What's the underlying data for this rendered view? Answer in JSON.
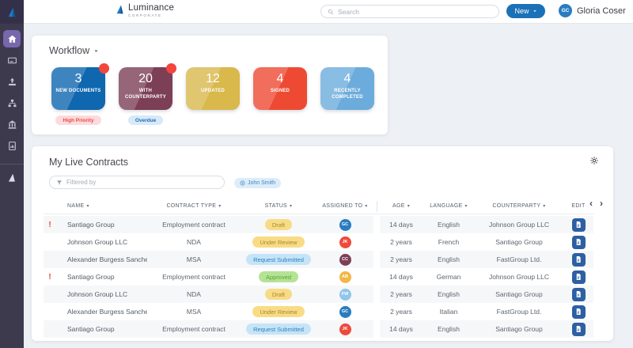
{
  "topbar": {
    "brand_name": "Luminance",
    "brand_sub": "CORPORATE",
    "search_placeholder": "Search",
    "new_label": "New",
    "user_initials": "GC",
    "user_name": "Gloria Coser"
  },
  "sidebar": {
    "items": [
      {
        "name": "home",
        "icon": "home-icon",
        "active": true
      },
      {
        "name": "documents",
        "icon": "card-icon",
        "active": false
      },
      {
        "name": "upload",
        "icon": "upload-icon",
        "active": false
      },
      {
        "name": "hierarchy",
        "icon": "hierarchy-icon",
        "active": false
      },
      {
        "name": "organisation",
        "icon": "bank-icon",
        "active": false
      },
      {
        "name": "reports",
        "icon": "report-icon",
        "active": false
      }
    ],
    "footer_icon": "sail-icon"
  },
  "workflow": {
    "title": "Workflow",
    "cards": [
      {
        "value": "3",
        "label": "NEW DOCUMENTS",
        "color": "#0e67af",
        "dot": true,
        "badge": {
          "text": "High Priority",
          "bg": "#fbdbdd",
          "color": "#ee4a42"
        }
      },
      {
        "value": "20",
        "label": "WITH COUNTERPARTY",
        "color": "#7c3f55",
        "dot": true,
        "badge": {
          "text": "Overdue",
          "bg": "#d8e9f8",
          "color": "#1e6fb8"
        }
      },
      {
        "value": "12",
        "label": "UPDATED",
        "color": "#d9b84c",
        "dot": false
      },
      {
        "value": "4",
        "label": "SIGNED",
        "color": "#ee4a33",
        "dot": false
      },
      {
        "value": "4",
        "label": "RECENTLY COMPLETED",
        "color": "#6cacdc",
        "dot": false
      }
    ]
  },
  "contracts": {
    "title": "My Live Contracts",
    "filter_placeholder": "Filtered by",
    "chip_label": "John Smith",
    "columns": [
      {
        "label": "NAME",
        "sortable": true
      },
      {
        "label": "CONTRACT TYPE",
        "sortable": true
      },
      {
        "label": "STATUS",
        "sortable": true
      },
      {
        "label": "ASSIGNED TO",
        "sortable": true
      },
      {
        "label": "AGE",
        "sortable": true
      },
      {
        "label": "LANGUAGE",
        "sortable": true
      },
      {
        "label": "COUNTERPARTY",
        "sortable": true
      },
      {
        "label": "EDIT",
        "sortable": false
      }
    ],
    "status_styles": {
      "Draft": {
        "bg": "#f8dc85",
        "color": "#a8872f"
      },
      "Under Review": {
        "bg": "#f8dc85",
        "color": "#a8872f"
      },
      "Request Submitted": {
        "bg": "#c6e4f7",
        "color": "#2b80c2"
      },
      "Approved": {
        "bg": "#b4e394",
        "color": "#5fa039"
      }
    },
    "avatar_colors": {
      "GC": "#2a7cc0",
      "JK": "#ee4a3b",
      "CC": "#7c4055",
      "AB": "#f2b843",
      "FW": "#8fc6ea"
    },
    "rows": [
      {
        "priority": true,
        "name": "Santiago Group",
        "type": "Employment contract",
        "status": "Draft",
        "assignee": "GC",
        "age": "14 days",
        "language": "English",
        "counterparty": "Johnson Group LLC"
      },
      {
        "priority": false,
        "name": "Johnson Group LLC",
        "type": "NDA",
        "status": "Under Review",
        "assignee": "JK",
        "age": "2 years",
        "language": "French",
        "counterparty": "Santiago Group"
      },
      {
        "priority": false,
        "name": "Alexander Burgess Sanchezz",
        "type": "MSA",
        "status": "Request Submitted",
        "assignee": "CC",
        "age": "2 years",
        "language": "English",
        "counterparty": "FastGroup Ltd."
      },
      {
        "priority": true,
        "name": "Santiago Group",
        "type": "Employment contract",
        "status": "Approved",
        "assignee": "AB",
        "age": "14 days",
        "language": "German",
        "counterparty": "Johnson Group LLC"
      },
      {
        "priority": false,
        "name": "Johnson Group LLC",
        "type": "NDA",
        "status": "Draft",
        "assignee": "FW",
        "age": "2 years",
        "language": "English",
        "counterparty": "Santiago Group"
      },
      {
        "priority": false,
        "name": "Alexander Burgess Sanchezz",
        "type": "MSA",
        "status": "Under Review",
        "assignee": "GC",
        "age": "2 years",
        "language": "Italian",
        "counterparty": "FastGroup Ltd."
      },
      {
        "priority": false,
        "name": "Santiago Group",
        "type": "Employment contract",
        "status": "Request Submitted",
        "assignee": "JK",
        "age": "14 days",
        "language": "English",
        "counterparty": "Santiago Group"
      }
    ],
    "pager": {
      "prev": "‹",
      "next": "›"
    }
  }
}
